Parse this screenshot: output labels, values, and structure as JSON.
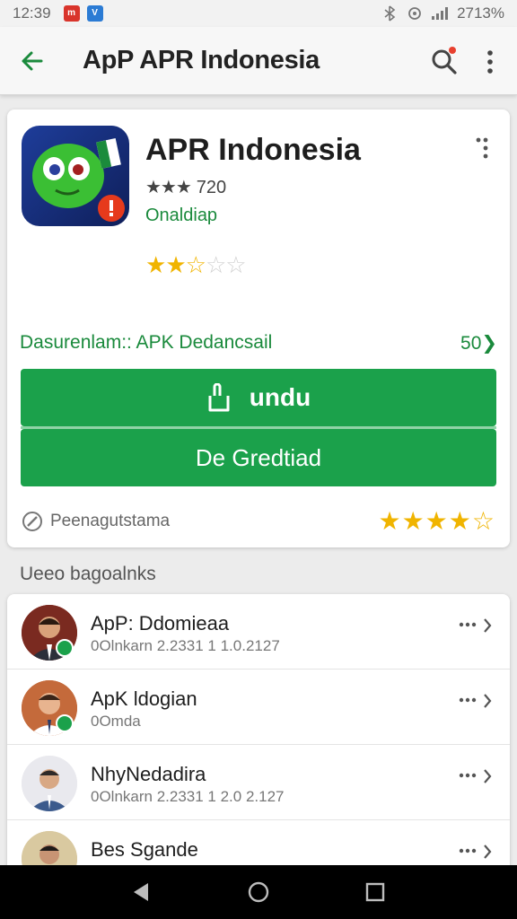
{
  "status_bar": {
    "time": "12:39",
    "battery_text": "2713%",
    "badge_colors": [
      "#d9342b",
      "#2b7bd4"
    ]
  },
  "app_bar": {
    "title": "ApP APR Indonesia",
    "back_icon": "arrow-back-icon",
    "search_icon": "search-icon",
    "more_icon": "more-vert-icon",
    "accent": "#1a8a3c"
  },
  "app_card": {
    "name": "APR Indonesia",
    "mini_rating_stars": "★★★",
    "mini_rating_count": "720",
    "developer": "Onaldiap",
    "rating_visual": {
      "full": 2,
      "half": 1,
      "empty": 2
    },
    "meta_label": "Dasurenlam:: APK Dedancsail",
    "meta_value": "50",
    "install_button": "undu",
    "download_button": "De Gredtiad",
    "bottom_label": "Peenagutstama",
    "bottom_rating_visual": {
      "full": 4,
      "outline": 1
    },
    "brand_green": "#1ba14b"
  },
  "section": {
    "title": "Ueeo bagoalnks"
  },
  "list": {
    "items": [
      {
        "title": "ApP: Ddomieaa",
        "subtitle": "0Olnkarn 2.2331 1 1.0.2127",
        "avatar_bg": "#b0362a",
        "badge": true
      },
      {
        "title": "ApK ldogian",
        "subtitle": "0Omda",
        "avatar_bg": "#c46a3b",
        "badge": true
      },
      {
        "title": "NhyNedadira",
        "subtitle": "0Olnkarn 2.2331 1 2.0 2.127",
        "avatar_bg": "#e9e9ee",
        "badge": false
      },
      {
        "title": "Bes Sgande",
        "subtitle": "",
        "avatar_bg": "#d9c9a0",
        "badge": false
      }
    ]
  },
  "nav_bar": {
    "back_icon": "nav-back-icon",
    "home_icon": "nav-home-icon",
    "recents_icon": "nav-recents-icon"
  }
}
